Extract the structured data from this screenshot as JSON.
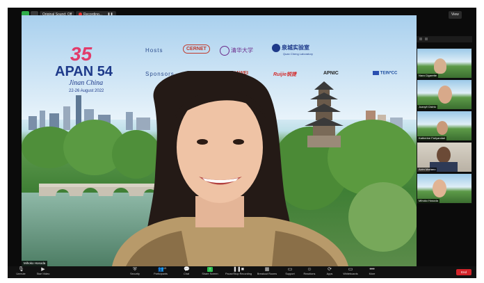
{
  "topbar": {
    "original_sound_label": "Original Sound: Off",
    "recording_label": "Recording...",
    "view_label": "View"
  },
  "conference": {
    "logo_number": "35",
    "logo_title": "APAN 54",
    "logo_city": "Jinan China",
    "logo_dates": "22-26 August 2022",
    "hosts_label": "Hosts",
    "sponsors_label": "Sponsors",
    "hosts": [
      "CERNET",
      "清华大学",
      "泉城实验室"
    ],
    "host_sub": "Quan Cheng Laboratory",
    "sponsors": [
      "HUAWEI",
      "Ruijie锐捷",
      "APNIC",
      "TEIN*CC"
    ]
  },
  "speaker": {
    "name": "Mihoko Hosoda"
  },
  "gallery": {
    "participants": [
      {
        "name": "Nara Cigarette"
      },
      {
        "name": "Joanyll Cistrio"
      },
      {
        "name": "Katherine Farlyandari"
      },
      {
        "name": "Azim Mariano"
      },
      {
        "name": "Mihoko Hosoda"
      }
    ]
  },
  "toolbar": {
    "unmute": "Unmute",
    "start_video": "Start Video",
    "security": "Security",
    "participants": "Participants",
    "participants_count": "15",
    "chat": "Chat",
    "share_screen": "Share Screen",
    "recording": "Pause/Stop Recording",
    "breakout": "Breakout Rooms",
    "support": "Support",
    "reactions": "Reactions",
    "apps": "Apps",
    "whiteboards": "Whiteboards",
    "more": "More",
    "end": "End"
  },
  "colors": {
    "end_button": "#d3242a",
    "share_button": "#2fbf4f",
    "title_blue": "#1e3a8a",
    "logo_pink": "#e23b6a"
  }
}
